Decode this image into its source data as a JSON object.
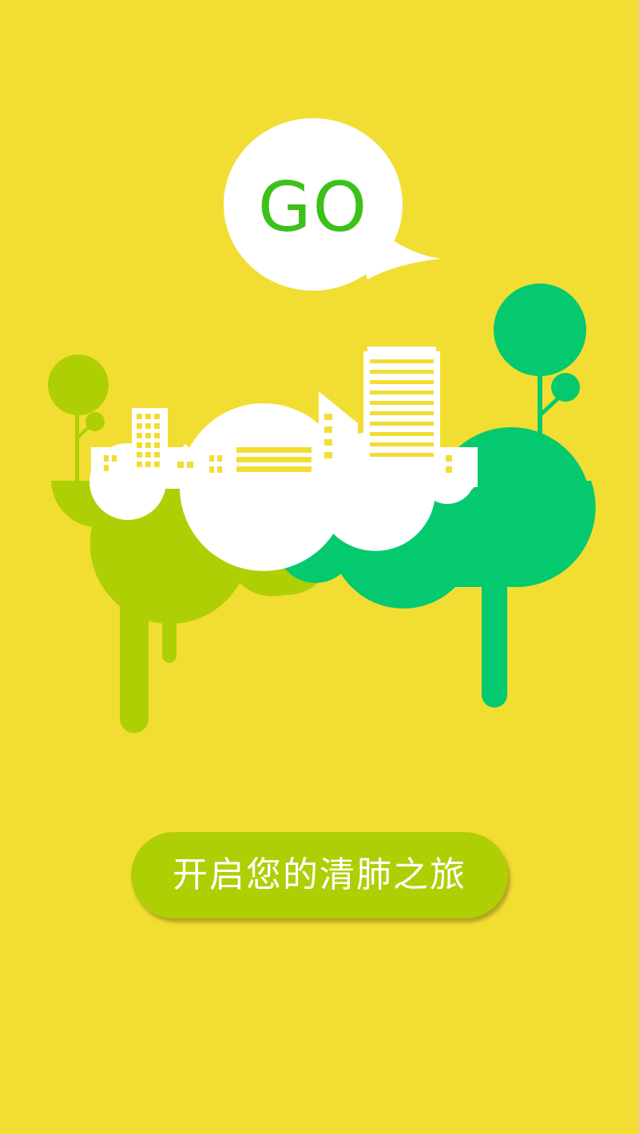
{
  "colors": {
    "background": "#f2dd33",
    "light_green": "#afcf05",
    "dark_green": "#05c96e",
    "go_text": "#3cc11a",
    "white": "#ffffff"
  },
  "speech_bubble": {
    "text": "GO"
  },
  "illustration": {
    "icon": "floating-island-city-icon"
  },
  "start_button": {
    "label": "开启您的清肺之旅"
  }
}
